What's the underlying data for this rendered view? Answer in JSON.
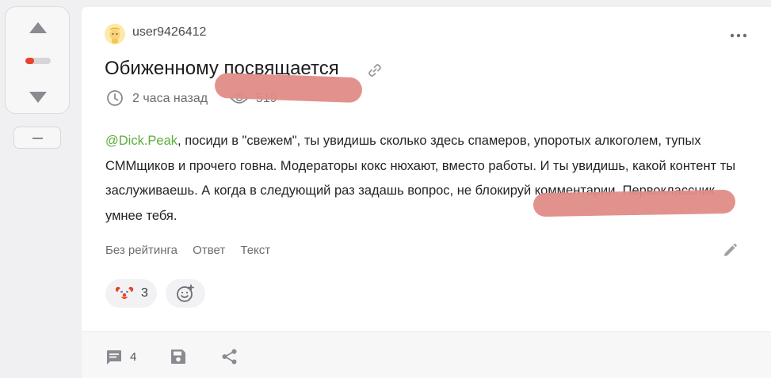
{
  "post": {
    "author": "user9426412",
    "title": "Обиженному посвящается",
    "time": "2 часа назад",
    "views": "519",
    "body": {
      "mention": "@Dick.Peak",
      "text": ", посиди в \"свежем\", ты увидишь сколько здесь спамеров, упоротых алкоголем, тупых СММщиков и прочего говна. Модераторы кокс нюхают, вместо работы. И ты увидишь, какой контент ты заслуживаешь. А когда в следующий раз задашь вопрос, не блокируй комментарии. Первоклассник умнее тебя."
    },
    "tags": [
      "Без рейтинга",
      "Ответ",
      "Текст"
    ],
    "reactions": [
      {
        "icon": "clown-face-icon",
        "count": "3"
      }
    ],
    "comments_count": "4"
  },
  "rating": {
    "negative_share": 0.35
  },
  "colors": {
    "accent_green": "#5cad3c",
    "rating_red": "#e8432c",
    "redaction": "#e08c87"
  }
}
